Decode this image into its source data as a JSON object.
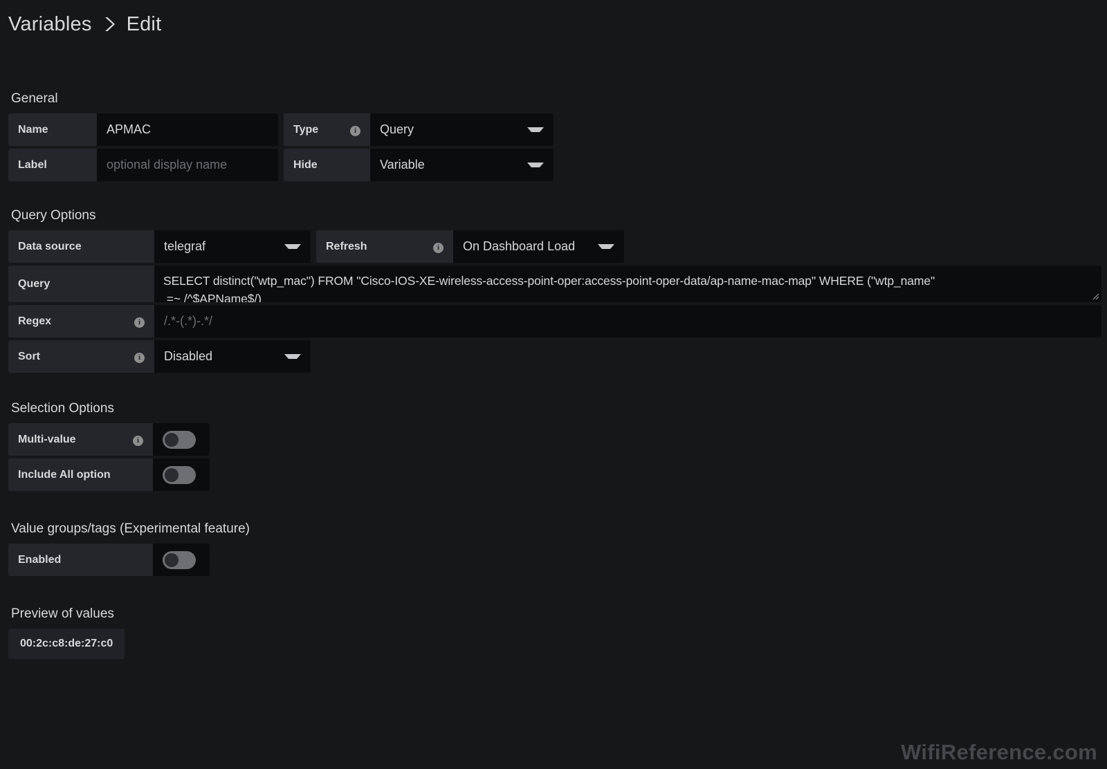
{
  "breadcrumb": {
    "root": "Variables",
    "separator_icon": "chevron-right-icon",
    "current": "Edit"
  },
  "general": {
    "title": "General",
    "name": {
      "label": "Name",
      "value": "APMAC"
    },
    "label_field": {
      "label": "Label",
      "value": "",
      "placeholder": "optional display name"
    },
    "type": {
      "label": "Type",
      "value": "Query",
      "has_info": true
    },
    "hide": {
      "label": "Hide",
      "value": "Variable",
      "has_info": false
    }
  },
  "query_options": {
    "title": "Query Options",
    "data_source": {
      "label": "Data source",
      "value": "telegraf"
    },
    "refresh": {
      "label": "Refresh",
      "value": "On Dashboard Load",
      "has_info": true
    },
    "query": {
      "label": "Query",
      "line1": "SELECT distinct(\"wtp_mac\") FROM \"Cisco-IOS-XE-wireless-access-point-oper:access-point-oper-data/ap-name-mac-map\" WHERE (\"wtp_name\"",
      "line2": " =~ /^$APName$/)"
    },
    "regex": {
      "label": "Regex",
      "value": "",
      "placeholder": "/.*-(.*)-.*/",
      "has_info": true
    },
    "sort": {
      "label": "Sort",
      "value": "Disabled",
      "has_info": true
    }
  },
  "selection_options": {
    "title": "Selection Options",
    "multi_value": {
      "label": "Multi-value",
      "enabled": false,
      "has_info": true
    },
    "include_all": {
      "label": "Include All option",
      "enabled": false,
      "has_info": false
    }
  },
  "value_groups": {
    "title": "Value groups/tags (Experimental feature)",
    "enabled_row": {
      "label": "Enabled",
      "enabled": false
    }
  },
  "preview": {
    "title": "Preview of values",
    "values": [
      "00:2c:c8:de:27:c0"
    ]
  },
  "watermark": "WifiReference.com",
  "colors": {
    "page_bg": "#161719",
    "label_bg": "#24262b",
    "input_bg": "#0b0c0e",
    "text": "#d8d9da",
    "placeholder": "#6d6f74",
    "toggle_track": "#6e6f73",
    "toggle_knob": "#2b2c30",
    "chip_bg": "#212227",
    "watermark": "#45474b"
  }
}
